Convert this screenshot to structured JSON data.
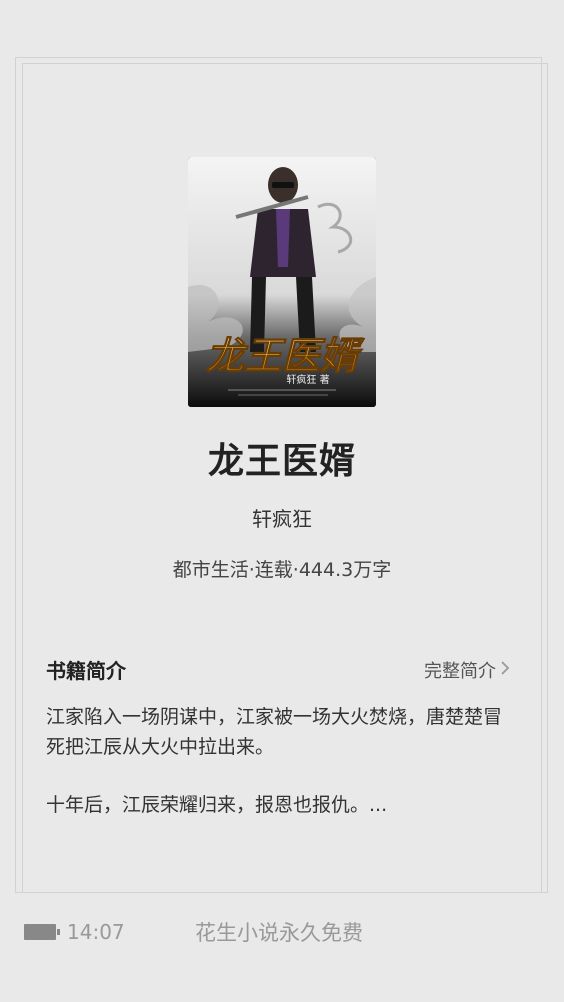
{
  "book": {
    "cover_title": "龙王医婿",
    "cover_author_line": "轩疯狂 著",
    "title": "龙王医婿",
    "author": "轩疯狂",
    "meta": "都市生活·连载·444.3万字"
  },
  "intro": {
    "section_title": "书籍简介",
    "full_link_label": "完整简介",
    "paragraphs": [
      "江家陷入一场阴谋中，江家被一场大火焚烧，唐楚楚冒死把江辰从大火中拉出来。",
      "十年后，江辰荣耀归来，报恩也报仇。..."
    ]
  },
  "status_bar": {
    "time": "14:07",
    "slogan": "花生小说永久免费",
    "battery_icon": "battery-icon"
  }
}
